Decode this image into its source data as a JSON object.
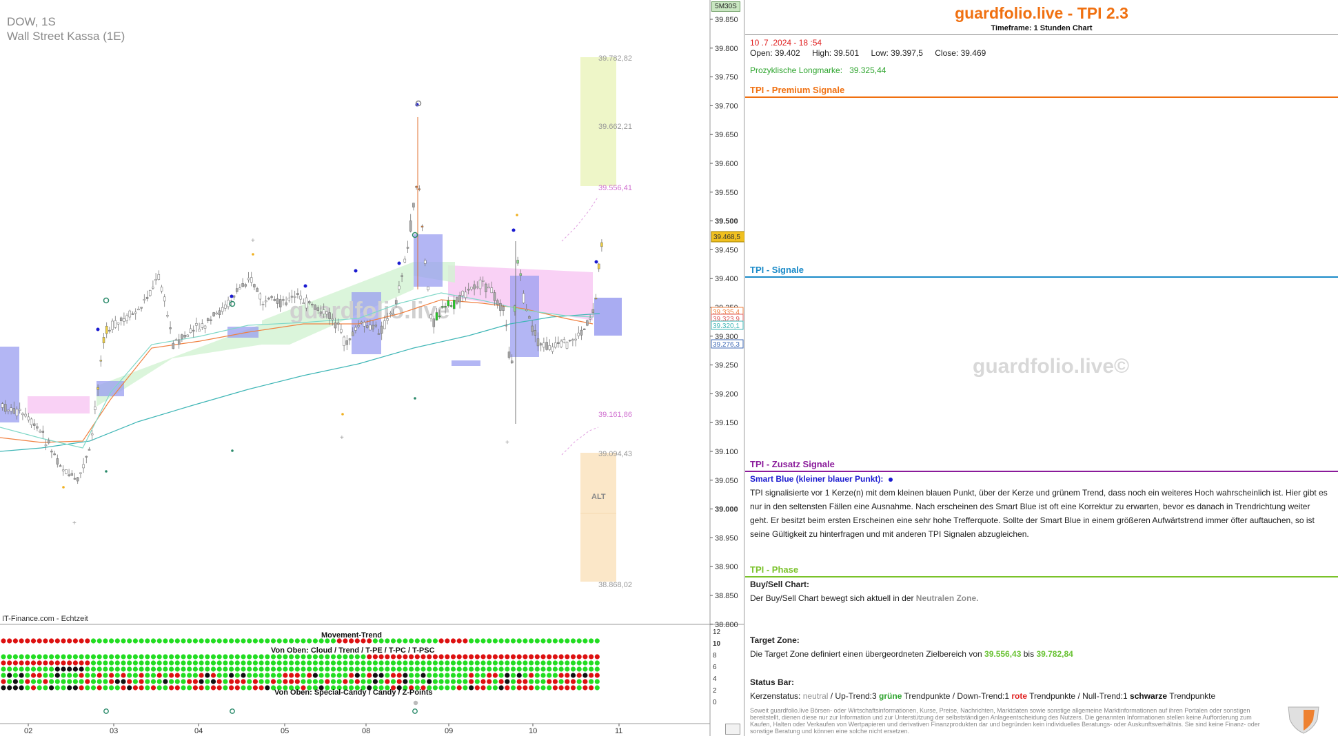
{
  "chart": {
    "symbol": "DOW, 1S",
    "instrument": "Wall Street Kassa (1E)",
    "feed_label": "IT-Finance.com - Echtzeit",
    "timeframe_button": "5M30S",
    "watermark": "guardfolio.live",
    "y_ticks": [
      "39.850",
      "39.800",
      "39.750",
      "39.700",
      "39.650",
      "39.600",
      "39.550",
      "39.500",
      "39.450",
      "39.400",
      "39.350",
      "39.300",
      "39.250",
      "39.200",
      "39.150",
      "39.100",
      "39.050",
      "39.000",
      "38.950",
      "38.900",
      "38.850",
      "38.800"
    ],
    "y_ticks_bold": [
      "39.500",
      "39.000"
    ],
    "price_tag": "39.468,5",
    "ma_tags": [
      "39.335,4",
      "39.323,9",
      "39.320,1",
      "39.276,3"
    ],
    "x_ticks": [
      "02",
      "03",
      "04",
      "05",
      "08",
      "09",
      "10",
      "11"
    ],
    "zone_levels": {
      "upper_top": "39.782,82",
      "upper_mid": "39.662,21",
      "upper_bottom": "39.556,41",
      "lower_top": "39.161,86",
      "lower_mid": "39.094,43",
      "lower_bottom": "38.868,02"
    },
    "lower_zone_label": "ALT",
    "indicator": {
      "title_top": "Movement-Trend",
      "title_mid": "Von Oben: Cloud / Trend / T-PE / T-PC / T-PSC",
      "title_bottom": "Von Oben: Special-Candy / Candy / Z-Points",
      "scale": [
        "12",
        "10",
        "8",
        "6",
        "4",
        "2",
        "0"
      ]
    },
    "colors": {
      "up": "#22dd22",
      "down": "#dd1111",
      "neutral": "#111111",
      "zone_upper": "#eef6c8",
      "zone_lower": "#fbe7c8",
      "cloud_pink": "#f7c6f2",
      "cloud_green": "#d2f2d2",
      "block_blue": "#9a9ef0"
    }
  },
  "panel": {
    "brand": "guardfolio.live - TPI 2.3",
    "timeframe": "Timeframe: 1 Stunden Chart",
    "datetime": "10 .7 .2024  - 18 :54",
    "ohlc": {
      "open": "Open:  39.402",
      "high": "High:  39.501",
      "low": "Low:  39.397,5",
      "close": "Close:  39.469"
    },
    "longmark_label": "Prozyklische Longmarke:",
    "longmark_value": "39.325,44",
    "sections": {
      "premium": "TPI - Premium Signale",
      "signals": "TPI - Signale",
      "extra": "TPI - Zusatz Signale",
      "phase": "TPI - Phase"
    },
    "smart_blue_title": "Smart Blue (kleiner blauer Punkt):",
    "smart_blue_text": "TPI signalisierte vor 1  Kerze(n) mit dem kleinen blauen Punkt, über der Kerze und grünem Trend, dass noch ein weiteres Hoch wahrscheinlich ist. Hier gibt es nur in den seltensten Fällen eine Ausnahme. Nach erscheinen des Smart Blue ist oft eine Korrektur zu erwarten, bevor es danach in Trendrichtung weiter geht. Er besitzt beim ersten Erscheinen eine sehr hohe Trefferquote. Sollte der Smart Blue in einem größeren Aufwärtstrend immer öfter auftauchen, so ist seine Gültigkeit zu hinterfragen und mit anderen TPI Signalen abzugleichen.",
    "buysell_title": "Buy/Sell Chart:",
    "buysell_prefix": "Der Buy/Sell Chart bewegt sich aktuell in der",
    "buysell_zone": "Neutralen Zone.",
    "target_title": "Target Zone:",
    "target_prefix": "Die Target Zone definiert einen übergeordneten Zielbereich von",
    "target_from": "39.556,43",
    "target_mid": "bis",
    "target_to": "39.782,84",
    "status_title": "Status Bar:",
    "status": {
      "label": "Kerzenstatus:",
      "state": "neutral",
      "up_pre": "/ Up-Trend:3",
      "up_word": "grüne",
      "up_post": "Trendpunkte  / Down-Trend:1",
      "down_word": "rote",
      "down_post": "Trendpunkte / Null-Trend:1",
      "null_word": "schwarze",
      "null_post": "Trendpunkte"
    },
    "watermark": "guardfolio.live©",
    "disclaimer": "Soweit guardfolio.live Börsen- oder Wirtschaftsinformationen, Kurse, Preise, Nachrichten, Marktdaten sowie sonstige allgemeine Marktinformationen auf ihren Portalen oder sonstigen bereitstellt, dienen diese nur zur Information und zur Unterstützung der selbstständigen Anlageentscheidung des Nutzers. Die genannten Informationen stellen keine Aufforderung zum Kaufen, Halten oder Verkaufen von Wertpapieren und derivativen Finanzprodukten dar und begründen kein individuelles Beratungs- oder Auskunftsverhältnis. Sie sind keine Finanz- oder sonstige Beratung und können eine solche nicht ersetzen.",
    "colors": {
      "brand": "#f07010",
      "premium": "#f07010",
      "signals": "#1a8ac8",
      "extra": "#8a1a9a",
      "phase": "#7ac22a"
    }
  }
}
